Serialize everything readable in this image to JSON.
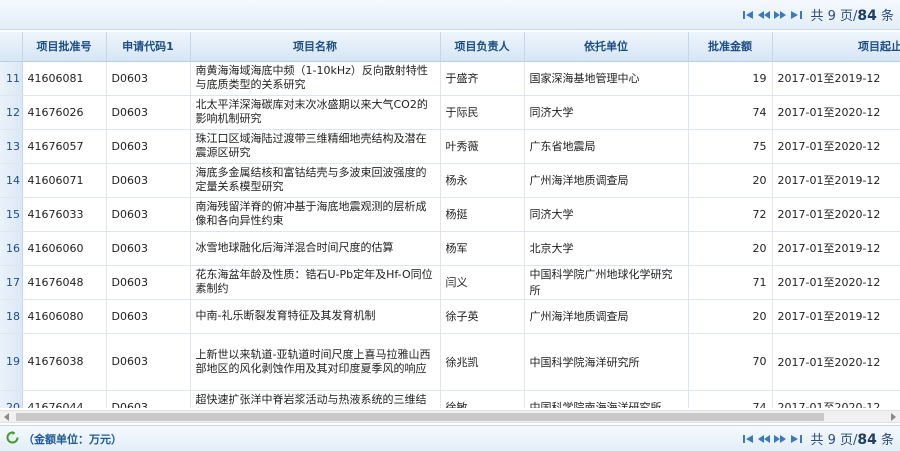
{
  "pager": {
    "info_prefix": "共 9 页/",
    "total": "84",
    "info_suffix": "条"
  },
  "footer": {
    "unit_label": "（金额单位：万元）"
  },
  "table": {
    "headers": [
      "",
      "项目批准号",
      "申请代码1",
      "项目名称",
      "项目负责人",
      "依托单位",
      "批准金额",
      "项目起止年月"
    ],
    "rows": [
      {
        "n": "11",
        "id": "41606081",
        "code": "D0603",
        "name": "南黄海海域海底中频（1-10kHz）反向散射特性与底质类型的关系研究",
        "leader": "于盛齐",
        "org": "国家深海基地管理中心",
        "amount": "19",
        "period": "2017-01至2019-12"
      },
      {
        "n": "12",
        "id": "41676026",
        "code": "D0603",
        "name": "北太平洋深海碳库对末次冰盛期以来大气CO2的影响机制研究",
        "leader": "于际民",
        "org": "同济大学",
        "amount": "74",
        "period": "2017-01至2020-12"
      },
      {
        "n": "13",
        "id": "41676057",
        "code": "D0603",
        "name": "珠江口区域海陆过渡带三维精细地壳结构及潜在震源区研究",
        "leader": "叶秀薇",
        "org": "广东省地震局",
        "amount": "75",
        "period": "2017-01至2020-12"
      },
      {
        "n": "14",
        "id": "41606071",
        "code": "D0603",
        "name": "海底多金属结核和富钴结壳与多波束回波强度的定量关系模型研究",
        "leader": "杨永",
        "org": "广州海洋地质调查局",
        "amount": "20",
        "period": "2017-01至2019-12"
      },
      {
        "n": "15",
        "id": "41676033",
        "code": "D0603",
        "name": "南海残留洋脊的俯冲基于海底地震观测的层析成像和各向异性约束",
        "leader": "杨挺",
        "org": "同济大学",
        "amount": "72",
        "period": "2017-01至2020-12"
      },
      {
        "n": "16",
        "id": "41606060",
        "code": "D0603",
        "name": "冰雪地球融化后海洋混合时间尺度的估算",
        "leader": "杨军",
        "org": "北京大学",
        "amount": "20",
        "period": "2017-01至2019-12"
      },
      {
        "n": "17",
        "id": "41676048",
        "code": "D0603",
        "name": "花东海盆年龄及性质：锆石U-Pb定年及Hf-O同位素制约",
        "leader": "闫义",
        "org": "中国科学院广州地球化学研究所",
        "amount": "71",
        "period": "2017-01至2020-12"
      },
      {
        "n": "18",
        "id": "41606080",
        "code": "D0603",
        "name": "中南-礼乐断裂发育特征及其发育机制",
        "leader": "徐子英",
        "org": "广州海洋地质调查局",
        "amount": "20",
        "period": "2017-01至2019-12"
      },
      {
        "n": "19",
        "id": "41676038",
        "code": "D0603",
        "name": "上新世以来轨道-亚轨道时间尺度上喜马拉雅山西部地区的风化剥蚀作用及其对印度夏季风的响应",
        "leader": "徐兆凯",
        "org": "中国科学院海洋研究所",
        "amount": "70",
        "period": "2017-01至2020-12"
      },
      {
        "n": "20",
        "id": "41676044",
        "code": "D0603",
        "name": "超快速扩张洋中脊岩浆活动与热液系统的三维结构及相互作用研究",
        "leader": "徐敏",
        "org": "中国科学院南海海洋研究所",
        "amount": "74",
        "period": "2017-01至2020-12"
      }
    ]
  },
  "colors": {
    "accent": "#1d4e86",
    "header_bg": "#d6e6f5",
    "pager_icon": "#3a78c2"
  }
}
